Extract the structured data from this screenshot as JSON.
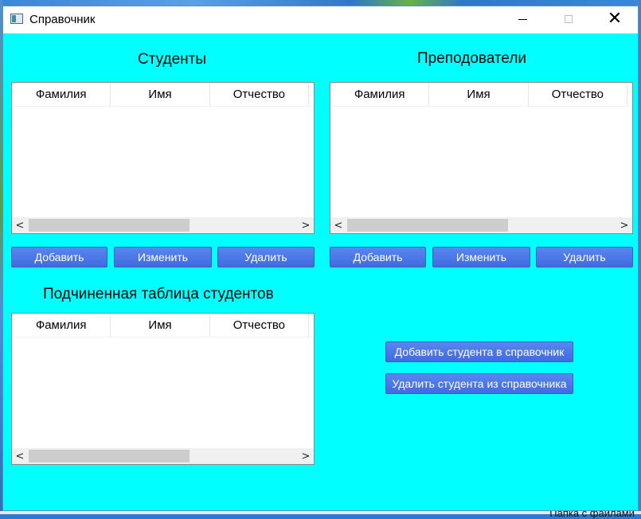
{
  "window": {
    "title": "Справочник"
  },
  "students": {
    "heading": "Студенты",
    "columns": [
      "Фамилия",
      "Имя",
      "Отчество"
    ],
    "buttons": {
      "add": "Добавить",
      "edit": "Изменить",
      "delete": "Удалить"
    }
  },
  "teachers": {
    "heading": "Преподователи",
    "columns": [
      "Фамилия",
      "Имя",
      "Отчество"
    ],
    "buttons": {
      "add": "Добавить",
      "edit": "Изменить",
      "delete": "Удалить"
    }
  },
  "sub_students": {
    "heading": "Подчиненная таблица студентов",
    "columns": [
      "Фамилия",
      "Имя",
      "Отчество"
    ]
  },
  "actions": {
    "add_to_directory": "Добавить студента в справочник",
    "remove_from_directory": "Удалить студента из справочника"
  },
  "desktop": {
    "partial_text": "Папка с файлами"
  },
  "colors": {
    "background": "#00ffff",
    "button": "#4a76e8"
  },
  "icons": {
    "minimize": "minimize-icon",
    "maximize": "maximize-icon",
    "close": "close-icon"
  }
}
